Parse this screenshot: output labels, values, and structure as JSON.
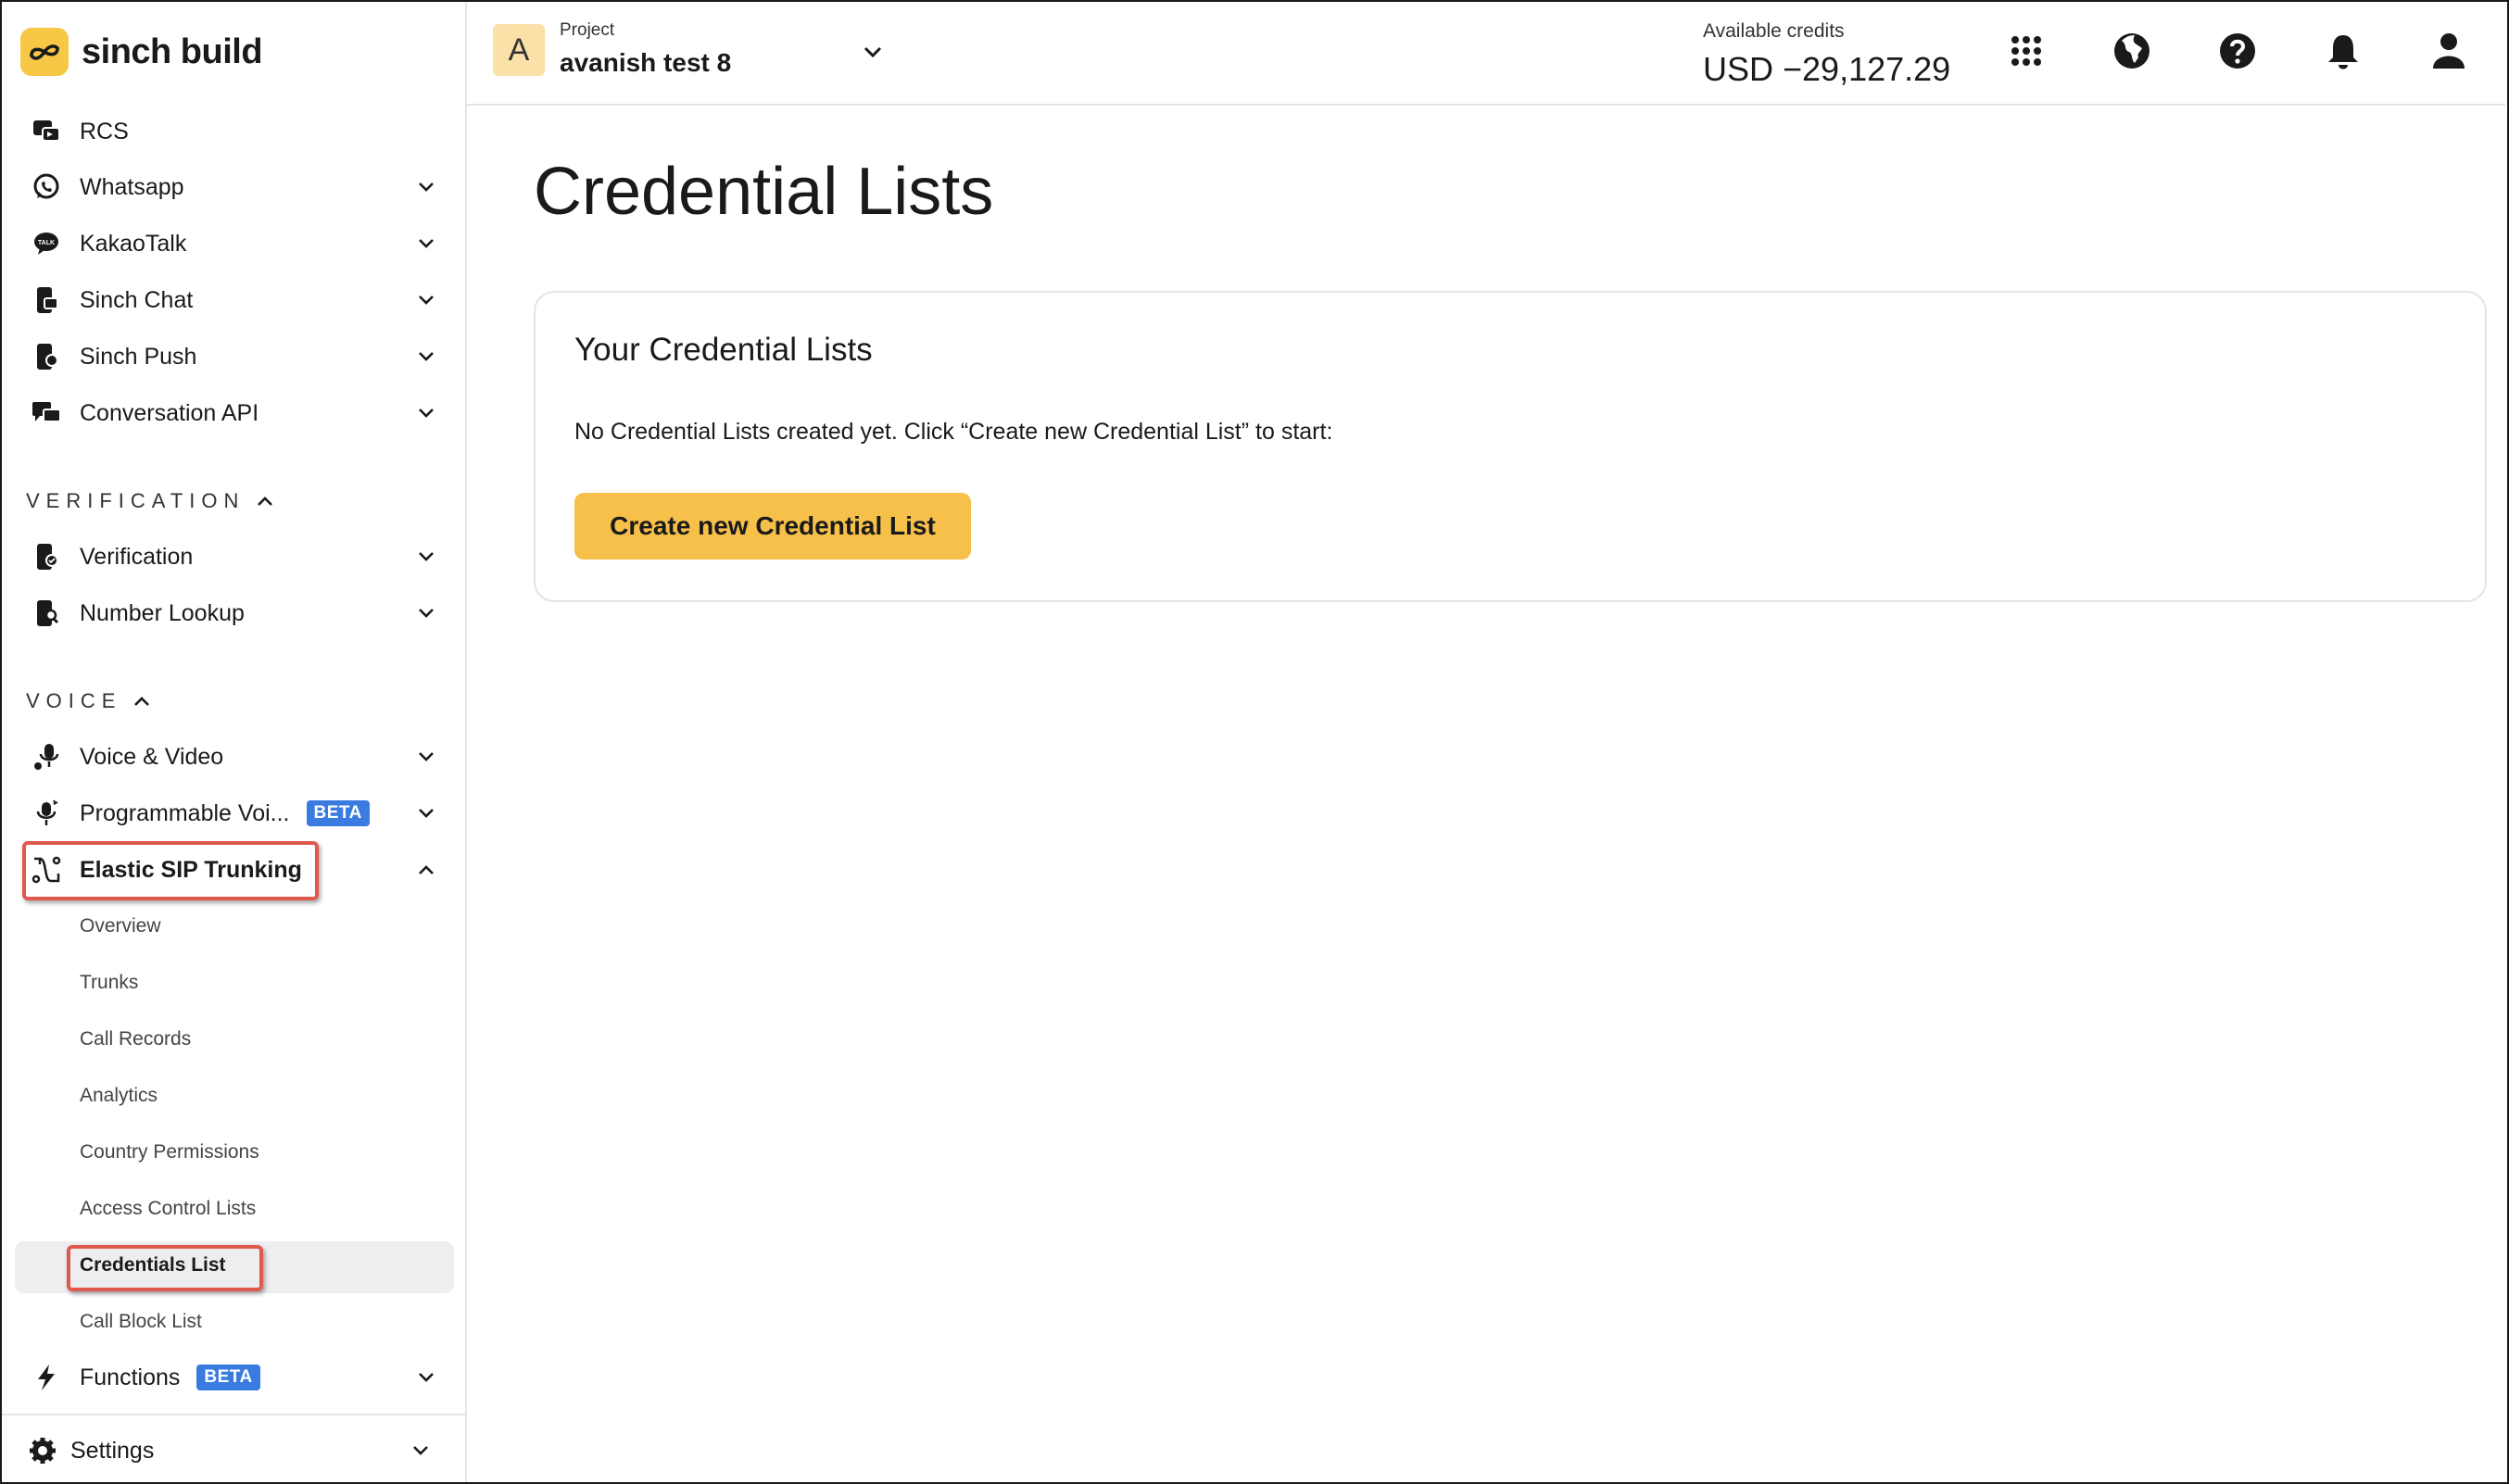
{
  "brand": {
    "name": "sinch build",
    "accent": "#f7c845"
  },
  "header": {
    "project_initial": "A",
    "project_label": "Project",
    "project_name": "avanish test 8",
    "credits_label": "Available credits",
    "credits_value": "USD −29,127.29"
  },
  "sidebar": {
    "items_top": [
      {
        "label": "RCS",
        "icon": "rcs-icon"
      },
      {
        "label": "Whatsapp",
        "icon": "whatsapp-icon"
      },
      {
        "label": "KakaoTalk",
        "icon": "kakaotalk-icon"
      },
      {
        "label": "Sinch Chat",
        "icon": "sinch-chat-icon"
      },
      {
        "label": "Sinch Push",
        "icon": "sinch-push-icon"
      },
      {
        "label": "Conversation API",
        "icon": "conversation-api-icon"
      }
    ],
    "verification_section": "VERIFICATION",
    "verification_items": [
      {
        "label": "Verification"
      },
      {
        "label": "Number Lookup"
      }
    ],
    "voice_section": "VOICE",
    "voice_items": [
      {
        "label": "Voice & Video"
      },
      {
        "label": "Programmable Voi...",
        "badge": "BETA"
      },
      {
        "label": "Elastic SIP Trunking"
      }
    ],
    "sip_sub_items": [
      "Overview",
      "Trunks",
      "Call Records",
      "Analytics",
      "Country Permissions",
      "Access Control Lists",
      "Credentials List",
      "Call Block List"
    ],
    "functions": {
      "label": "Functions",
      "badge": "BETA"
    },
    "settings": {
      "label": "Settings"
    }
  },
  "main": {
    "title": "Credential Lists",
    "card": {
      "title": "Your Credential Lists",
      "empty_text": "No Credential Lists created yet. Click “Create new Credential List” to start:",
      "button_label": "Create new Credential List"
    }
  }
}
